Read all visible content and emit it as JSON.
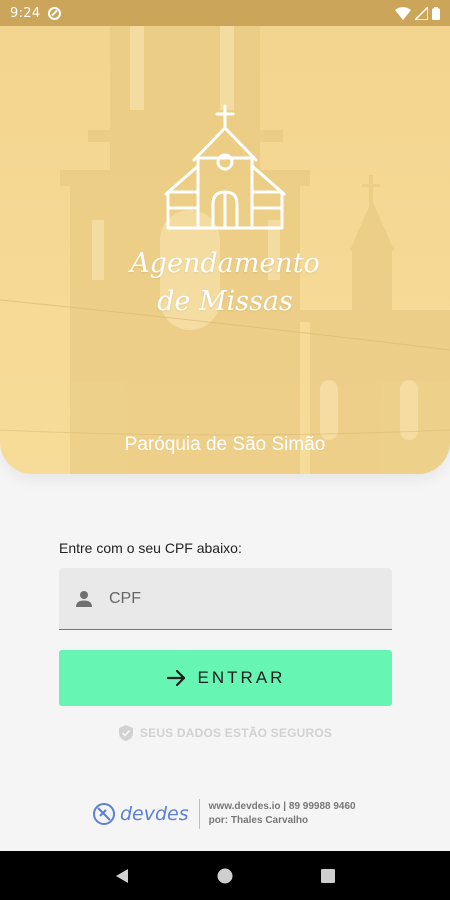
{
  "status_bar": {
    "time": "9:24",
    "icons": [
      "dnd-icon",
      "wifi-icon",
      "signal-icon",
      "battery-icon"
    ]
  },
  "hero": {
    "title_line1": "Agendamento",
    "title_line2": "de Missas",
    "parish": "Paróquia de São Simão"
  },
  "form": {
    "prompt": "Entre com o seu CPF abaixo:",
    "cpf_placeholder": "CPF",
    "cpf_value": "",
    "enter_label": "ENTRAR",
    "secure_text": "SEUS DADOS ESTÃO SEGUROS"
  },
  "footer": {
    "brand": "devdes",
    "line1": "www.devdes.io | 89 99988 9460",
    "line2": "por: Thales Carvalho"
  },
  "nav": [
    "back-icon",
    "home-icon",
    "recents-icon"
  ],
  "colors": {
    "hero": "#f5d893",
    "button": "#66f5b2",
    "brand": "#5c80d8",
    "background": "#f5f5f5"
  }
}
